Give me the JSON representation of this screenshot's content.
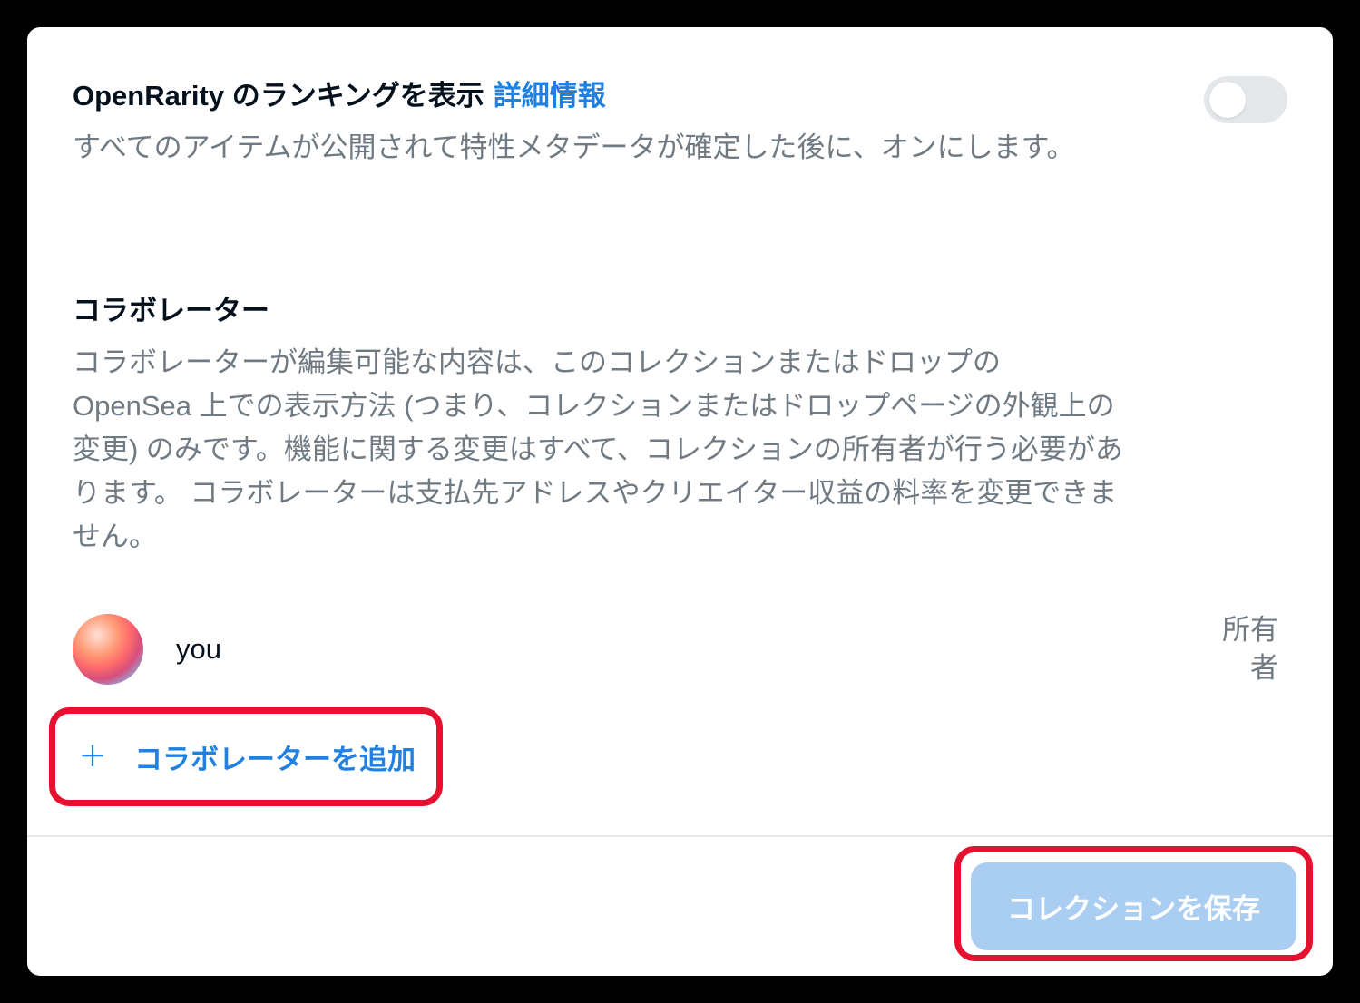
{
  "openrarity": {
    "title": "OpenRarity のランキングを表示",
    "details_link": "詳細情報",
    "description": "すべてのアイテムが公開されて特性メタデータが確定した後に、オンにします。",
    "toggle_on": false
  },
  "collaborators": {
    "title": "コラボレーター",
    "description": "コラボレーターが編集可能な内容は、このコレクションまたはドロップの OpenSea 上での表示方法 (つまり、コレクションまたはドロップページの外観上の変更) のみです。機能に関する変更はすべて、コレクションの所有者が行う必要があります。 コラボレーターは支払先アドレスやクリエイター収益の料率を変更できません。",
    "items": [
      {
        "name": "you",
        "role": "所有者"
      }
    ],
    "add_button": "コラボレーターを追加"
  },
  "footer": {
    "save_button": "コレクションを保存"
  },
  "colors": {
    "link": "#2081e2",
    "highlight": "#e6102f",
    "save_bg": "#a9cef2"
  }
}
